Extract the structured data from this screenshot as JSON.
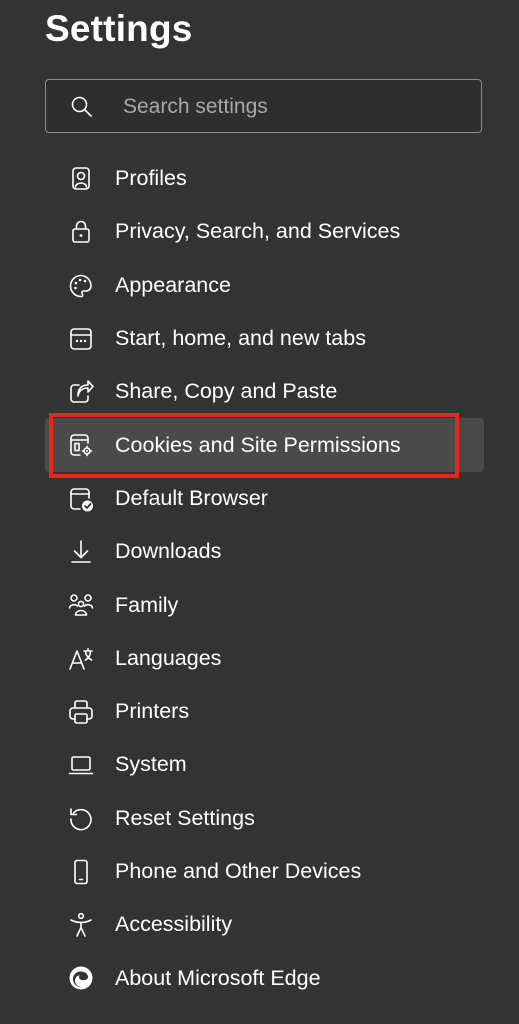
{
  "page": {
    "title": "Settings"
  },
  "search": {
    "placeholder": "Search settings"
  },
  "nav": {
    "items": [
      {
        "label": "Profiles",
        "icon": "profile-icon"
      },
      {
        "label": "Privacy, Search, and Services",
        "icon": "lock-icon"
      },
      {
        "label": "Appearance",
        "icon": "palette-icon"
      },
      {
        "label": "Start, home, and new tabs",
        "icon": "start-page-icon"
      },
      {
        "label": "Share, Copy and Paste",
        "icon": "share-icon"
      },
      {
        "label": "Cookies and Site Permissions",
        "icon": "site-permissions-icon",
        "selected": true
      },
      {
        "label": "Default Browser",
        "icon": "default-browser-icon"
      },
      {
        "label": "Downloads",
        "icon": "download-icon"
      },
      {
        "label": "Family",
        "icon": "family-icon"
      },
      {
        "label": "Languages",
        "icon": "languages-icon"
      },
      {
        "label": "Printers",
        "icon": "printer-icon"
      },
      {
        "label": "System",
        "icon": "laptop-icon"
      },
      {
        "label": "Reset Settings",
        "icon": "reset-icon"
      },
      {
        "label": "Phone and Other Devices",
        "icon": "phone-icon"
      },
      {
        "label": "Accessibility",
        "icon": "accessibility-icon"
      },
      {
        "label": "About Microsoft Edge",
        "icon": "edge-logo-icon"
      }
    ]
  },
  "colors": {
    "background": "#333333",
    "selected": "#4a4a4a",
    "highlight": "#e8261a",
    "text": "#ffffff"
  }
}
